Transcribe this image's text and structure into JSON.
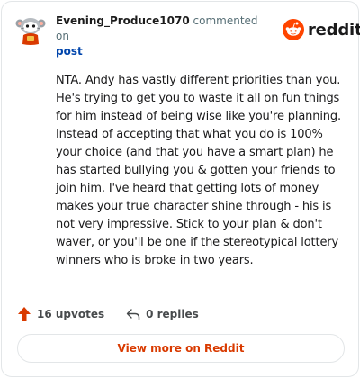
{
  "comment": {
    "username": "Evening_Produce1070",
    "action_text": "commented on",
    "post_link_label": "post",
    "body": "NTA. Andy has vastly different priorities than you. He's trying to get you to waste it all on fun things for him instead of being wise like you're planning. Instead of accepting that what you do is 100% your choice (and that you have a smart plan) he has started bullying you & gotten your friends to join him. I've heard that getting lots of money makes your true character shine through - his is not very impressive. Stick to your plan & don't waver, or you'll be one if the stereotypical lottery winners who is broke in two years."
  },
  "brand": {
    "name": "reddit",
    "color": "#ff4500"
  },
  "stats": {
    "upvotes_label": "16 upvotes",
    "replies_label": "0 replies"
  },
  "footer": {
    "view_more_label": "View more on Reddit"
  },
  "icons": {
    "avatar": "snoo-avatar-icon",
    "brand": "reddit-logo-icon",
    "upvote": "upvote-arrow-icon",
    "reply": "reply-arrow-icon"
  },
  "colors": {
    "accent": "#d93a00",
    "upvote": "#d93a00",
    "link": "#0045ac",
    "border": "#e3e6e8"
  }
}
